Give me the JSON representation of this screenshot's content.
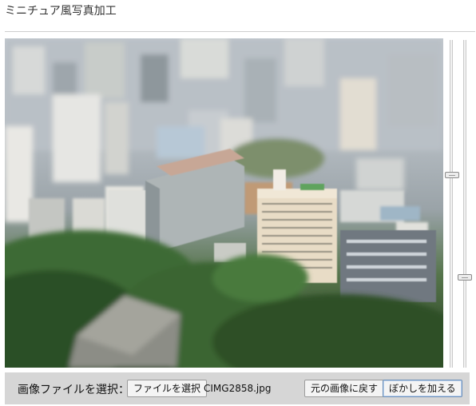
{
  "app": {
    "title": "ミニチュア風写真加工"
  },
  "photo": {
    "alt": "photo-preview"
  },
  "sliders": [
    {
      "name": "blur-area-slider",
      "value": 0.41
    },
    {
      "name": "blur-strength-slider",
      "value": 0.73
    }
  ],
  "toolbar": {
    "file_label": "画像ファイルを選択：",
    "choose_button": "ファイルを選択",
    "file_name": "CIMG2858.jpg",
    "restore_button": "元の画像に戻す",
    "blur_button": "ぼかしを加える"
  }
}
